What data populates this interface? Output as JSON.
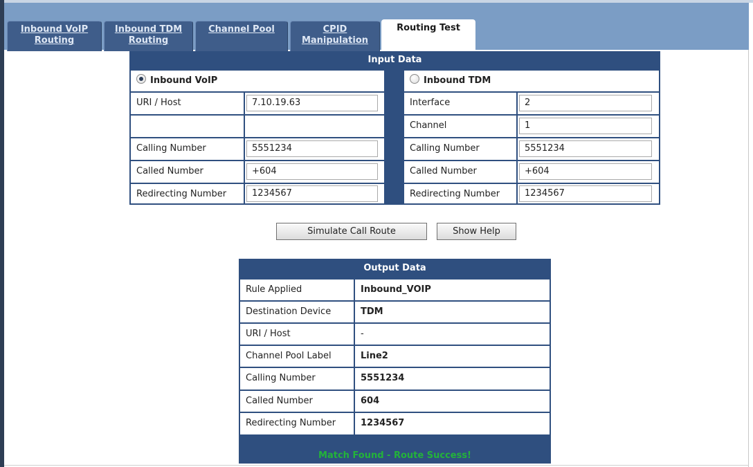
{
  "tabs": [
    {
      "line1": "Inbound VoIP",
      "line2": "Routing",
      "active": false
    },
    {
      "line1": "Inbound TDM",
      "line2": "Routing",
      "active": false
    },
    {
      "line1": "Channel Pool",
      "line2": "",
      "active": false
    },
    {
      "line1": "CPID",
      "line2": "Manipulation",
      "active": false
    },
    {
      "line1": "Routing Test",
      "line2": "",
      "active": true
    }
  ],
  "input": {
    "header": "Input Data",
    "voip": {
      "radio_label": "Inbound VoIP",
      "selected": true,
      "rows": [
        {
          "label": "URI / Host",
          "value": "7.10.19.63"
        },
        {
          "label": "",
          "value": ""
        },
        {
          "label": "Calling Number",
          "value": "5551234"
        },
        {
          "label": "Called Number",
          "value": "+604"
        },
        {
          "label": "Redirecting Number",
          "value": "1234567"
        }
      ]
    },
    "tdm": {
      "radio_label": "Inbound TDM",
      "selected": false,
      "rows": [
        {
          "label": "Interface",
          "value": "2"
        },
        {
          "label": "Channel",
          "value": "1"
        },
        {
          "label": "Calling Number",
          "value": "5551234"
        },
        {
          "label": "Called Number",
          "value": "+604"
        },
        {
          "label": "Redirecting Number",
          "value": "1234567"
        }
      ]
    }
  },
  "buttons": {
    "simulate": "Simulate Call Route",
    "help": "Show Help"
  },
  "output": {
    "header": "Output Data",
    "rows": [
      {
        "label": "Rule Applied",
        "value": "Inbound_VOIP"
      },
      {
        "label": "Destination Device",
        "value": "TDM"
      },
      {
        "label": "URI / Host",
        "value": "-"
      },
      {
        "label": "Channel Pool Label",
        "value": "Line2"
      },
      {
        "label": "Calling Number",
        "value": "5551234"
      },
      {
        "label": "Called Number",
        "value": "604"
      },
      {
        "label": "Redirecting Number",
        "value": "1234567"
      }
    ]
  },
  "status": "Match Found - Route Success!",
  "colors": {
    "panel_header": "#2f4f7f",
    "tab_bar": "#7b9dc5",
    "success": "#23b33a"
  }
}
